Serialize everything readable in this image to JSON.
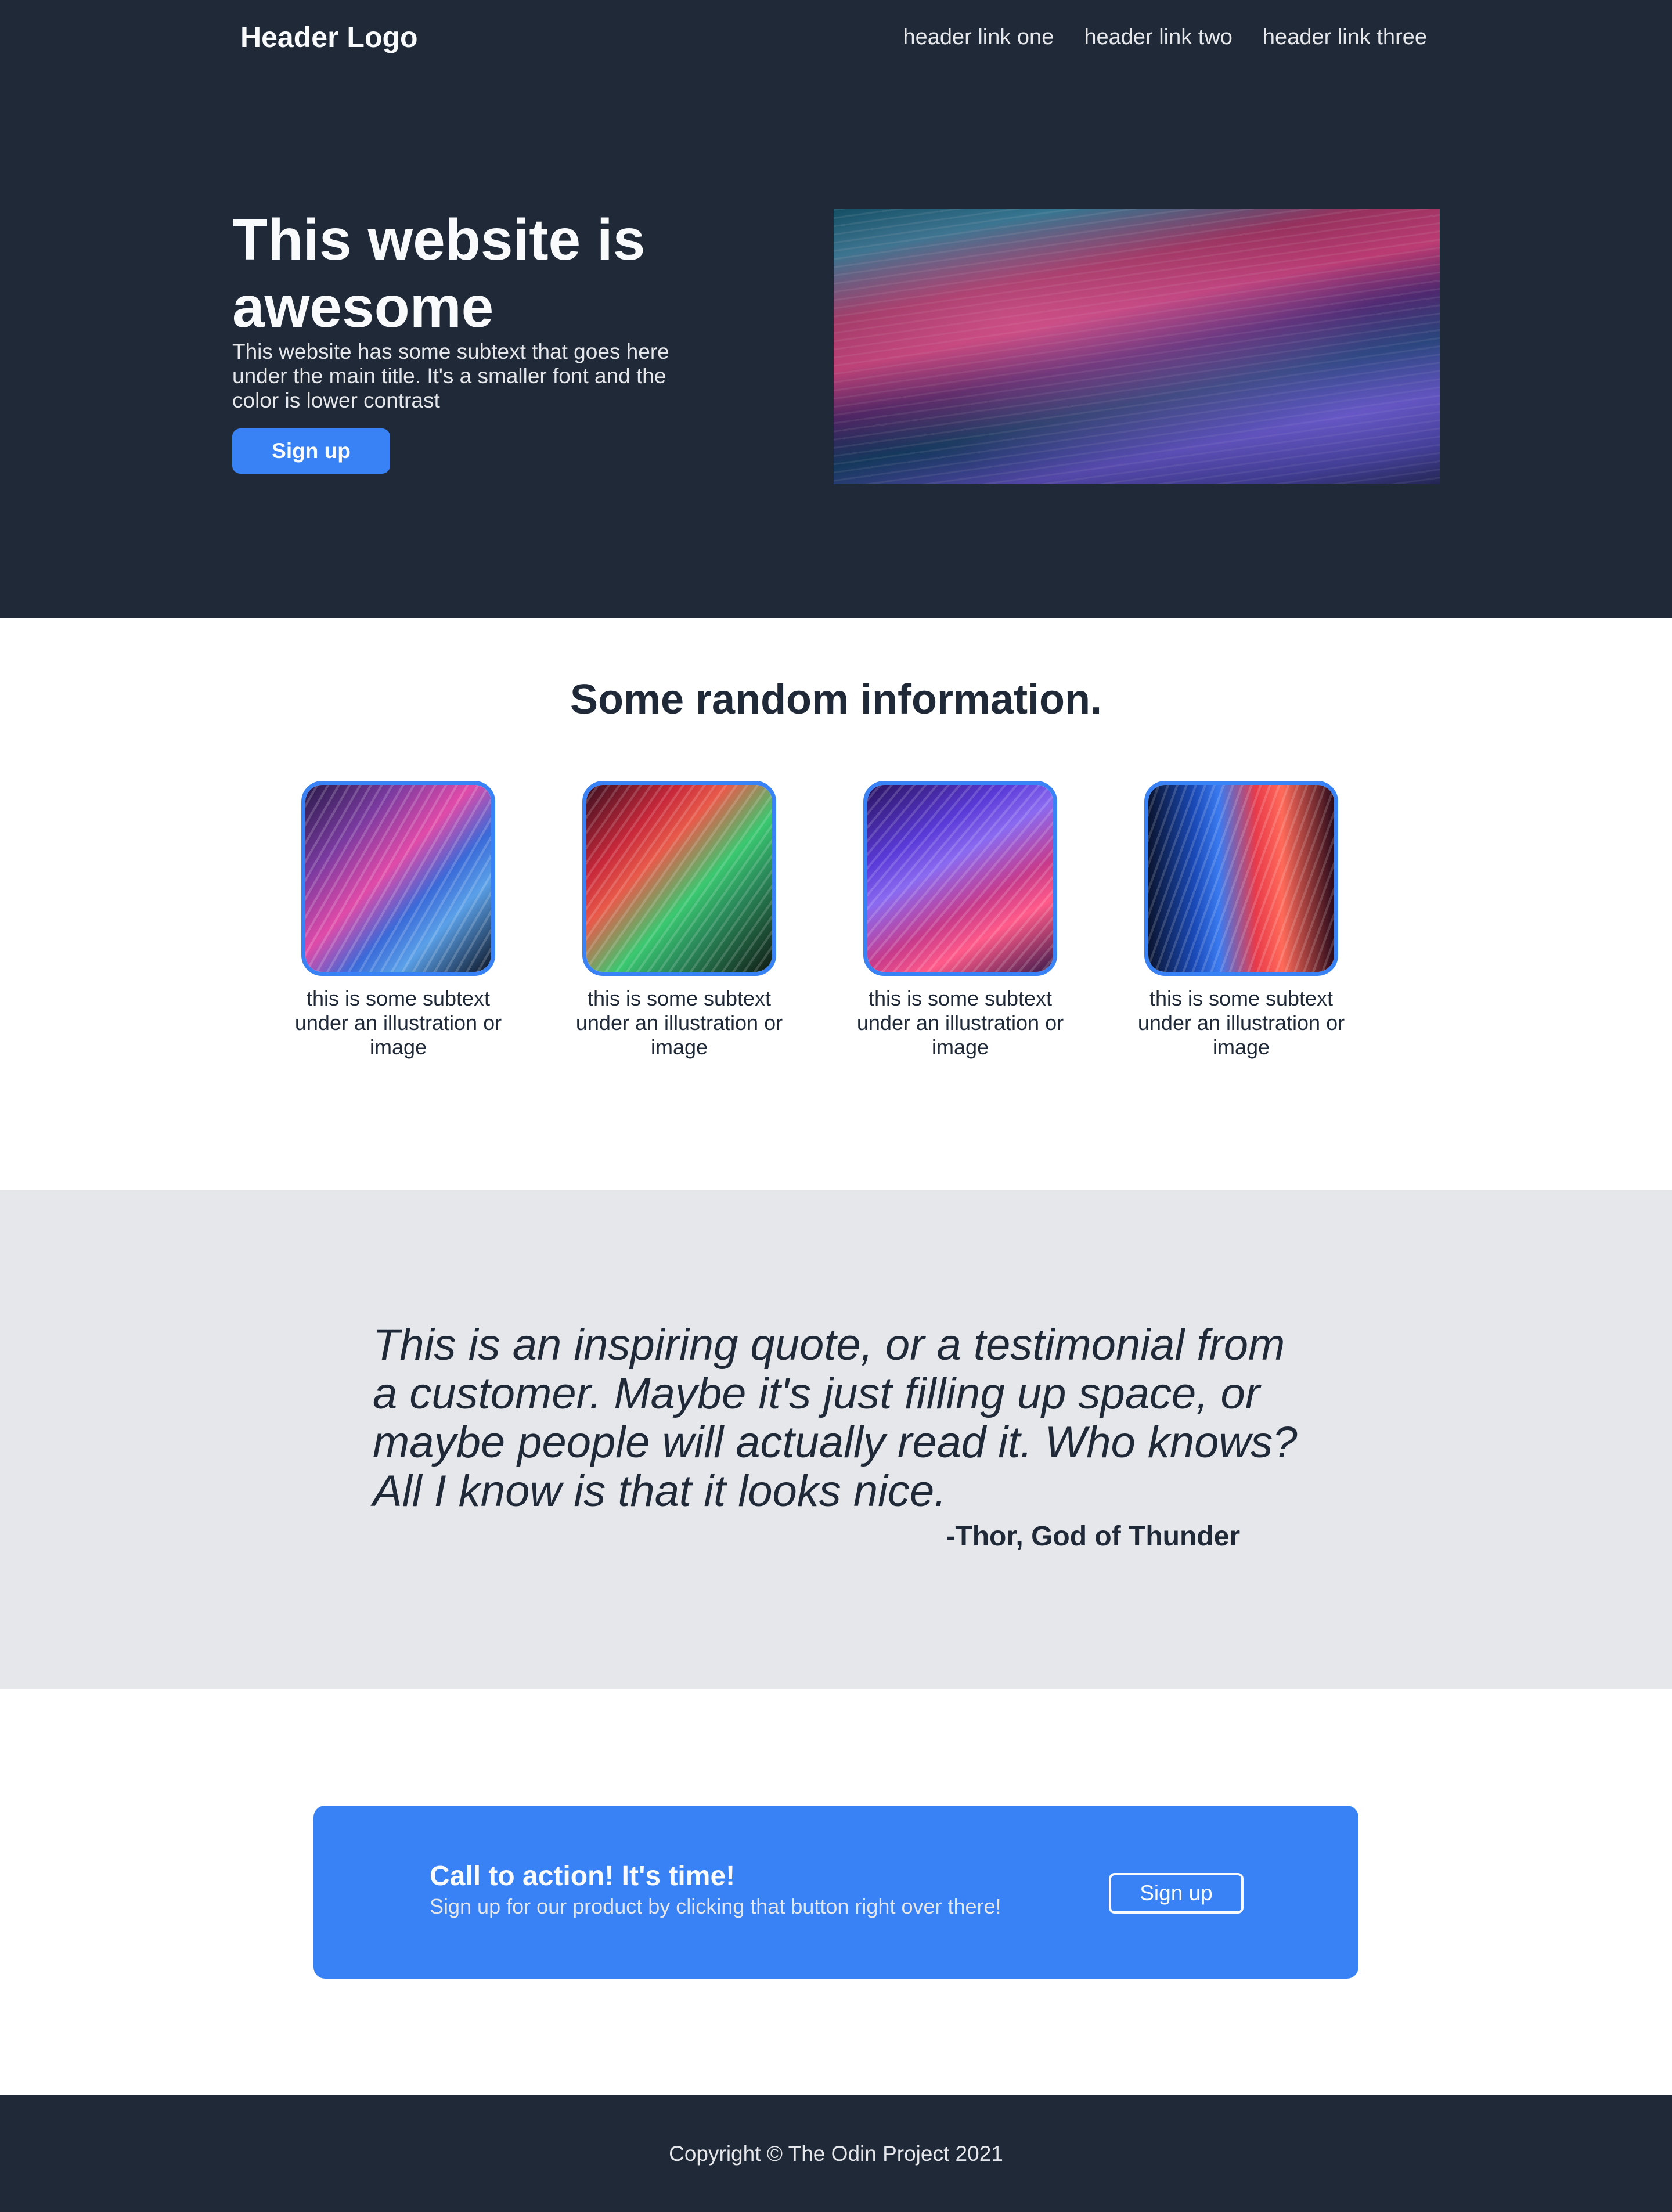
{
  "header": {
    "logo": "Header Logo",
    "links": [
      "header link one",
      "header link two",
      "header link three"
    ]
  },
  "hero": {
    "title": "This website is awesome",
    "subtext": "This website has some subtext that goes here under the main title. It's a smaller font and the color is lower contrast",
    "button_label": "Sign up"
  },
  "info": {
    "title": "Some random information.",
    "cards": [
      {
        "text": "this is some subtext under an illustration or image"
      },
      {
        "text": "this is some subtext under an illustration or image"
      },
      {
        "text": "this is some subtext under an illustration or image"
      },
      {
        "text": "this is some subtext under an illustration or image"
      }
    ]
  },
  "quote": {
    "text": "This is an inspiring quote, or a testimonial from a customer. Maybe it's just filling up space, or maybe people will actually read it. Who knows? All I know is that it looks nice.",
    "author": "-Thor, God of Thunder"
  },
  "cta": {
    "title": "Call to action! It's time!",
    "subtext": "Sign up for our product by clicking that button right over there!",
    "button_label": "Sign up"
  },
  "footer": {
    "copyright": "Copyright © The Odin Project 2021"
  },
  "colors": {
    "dark": "#1f2937",
    "accent": "#3882f6",
    "light_gray": "#e5e7eb",
    "white": "#f9fafb"
  }
}
